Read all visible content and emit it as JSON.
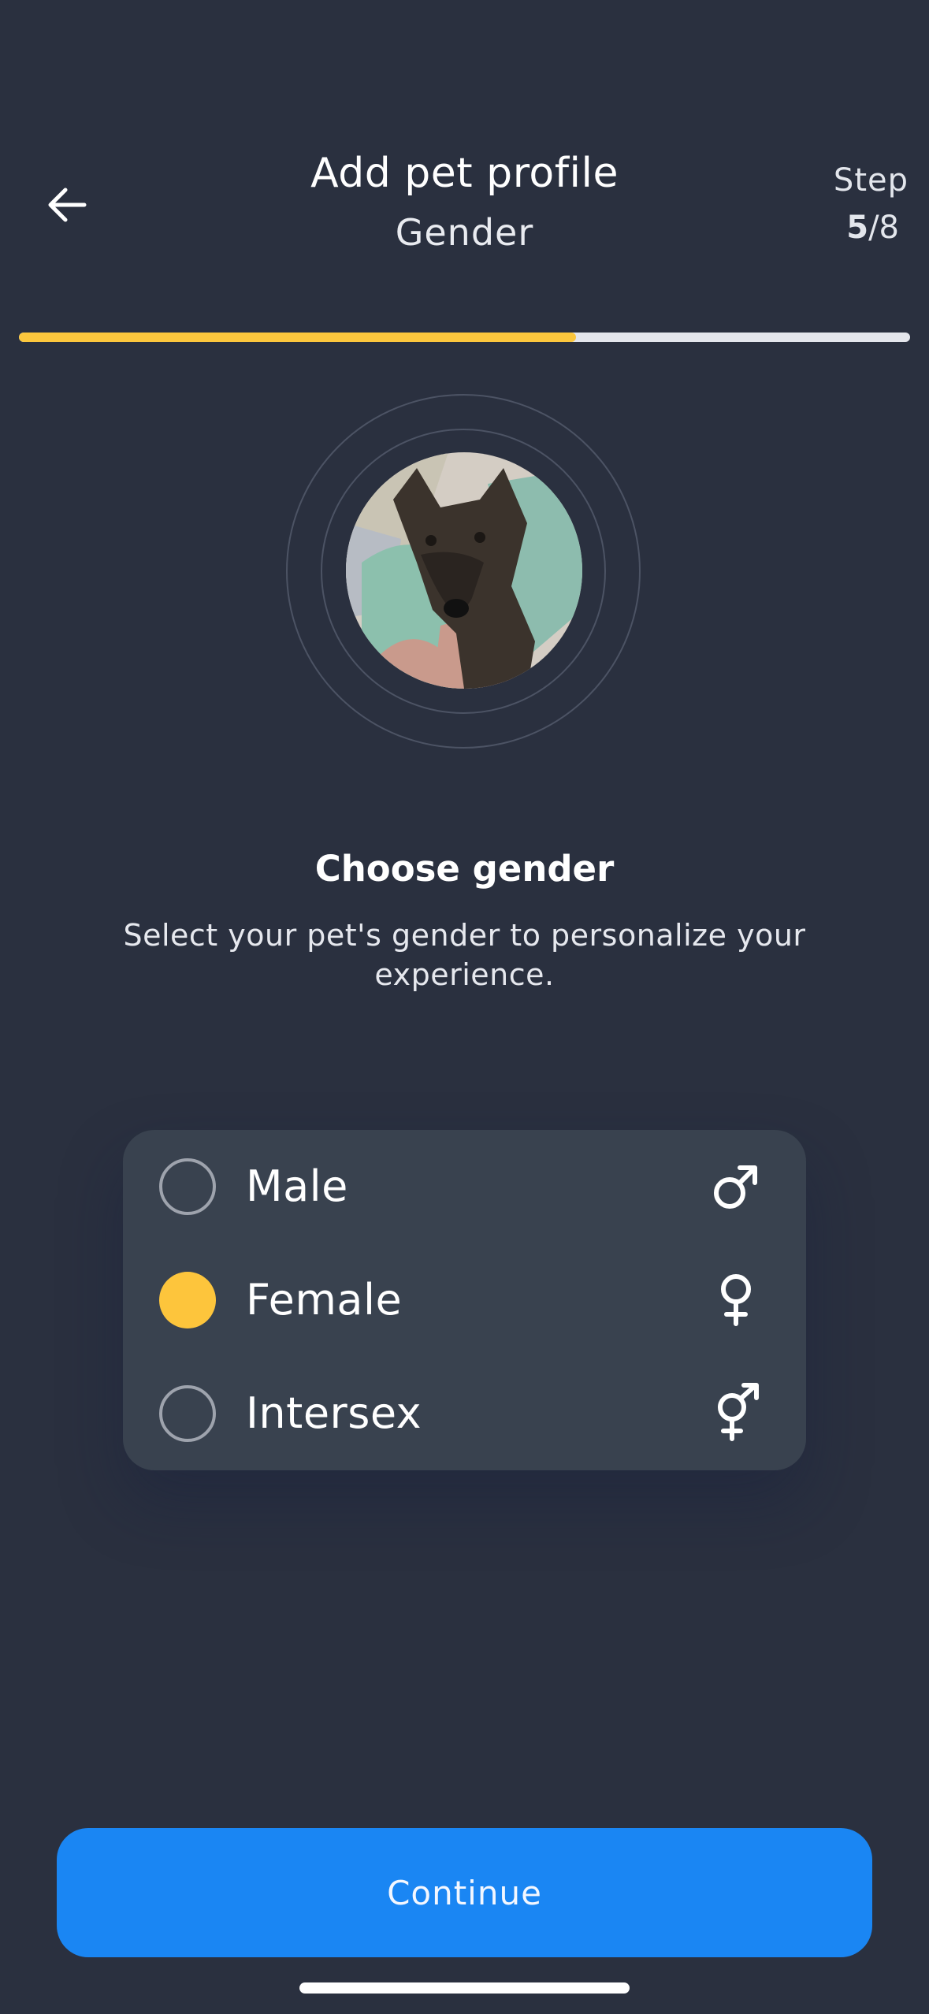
{
  "header": {
    "title": "Add pet profile",
    "subtitle": "Gender",
    "step_label": "Step",
    "step_current": "5",
    "step_total": "/8",
    "progress": 0.625,
    "progress_color": "#fcc73d",
    "back_icon": "arrow-left-icon"
  },
  "pet": {
    "photo_icon": "pet-photo"
  },
  "section": {
    "title": "Choose gender",
    "description": "Select your pet's gender to personalize your experience."
  },
  "options": [
    {
      "label": "Male",
      "icon": "male-symbol-icon",
      "selected": false
    },
    {
      "label": "Female",
      "icon": "female-symbol-icon",
      "selected": true
    },
    {
      "label": "Intersex",
      "icon": "intersex-symbol-icon",
      "selected": false
    }
  ],
  "footer": {
    "continue_label": "Continue",
    "accent": "#1a86f3"
  }
}
